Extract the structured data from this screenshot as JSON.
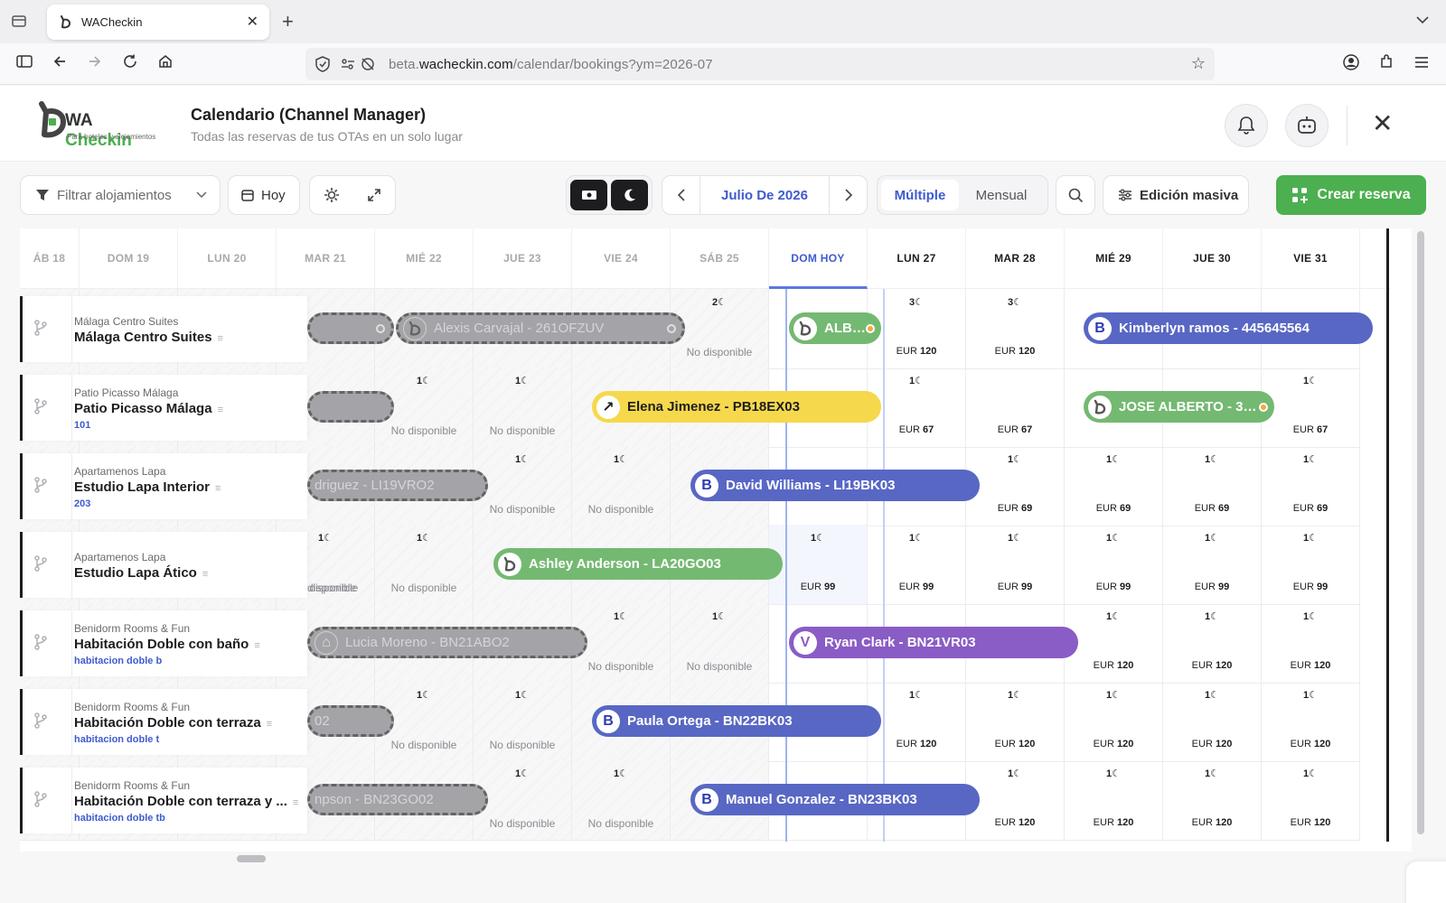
{
  "browser": {
    "tab_title": "WACheckin",
    "url_prefix": "beta.",
    "url_domain": "wacheckin.com",
    "url_path": "/calendar/bookings?ym=2026-07"
  },
  "header": {
    "logo_text_a": "WA ",
    "logo_text_b": "Checkin",
    "logo_tagline": "Para hoteles y alojamientos",
    "title": "Calendario (Channel Manager)",
    "subtitle": "Todas las reservas de tus OTAs en un solo lugar"
  },
  "toolbar": {
    "filter_label": "Filtrar alojamientos",
    "today_label": "Hoy",
    "month_label": "Julio De 2026",
    "view_multiple": "Múltiple",
    "view_monthly": "Mensual",
    "bulk_edit": "Edición masiva",
    "create": "Crear reserva"
  },
  "colors": {
    "accent": "#4caf50",
    "today": "#3e5bcf",
    "booking_blue": "#5867c4",
    "booking_green": "#74b972",
    "booking_yellow": "#f6d84c",
    "booking_purple": "#8a5cc5"
  },
  "days": [
    "ÁB 18",
    "DOM 19",
    "LUN 20",
    "MAR 21",
    "MIÉ 22",
    "JUE 23",
    "VIE 24",
    "SÁB 25",
    "DOM HOY",
    "LUN 27",
    "MAR 28",
    "MIÉ 29",
    "JUE 30",
    "VIE 31"
  ],
  "properties": [
    {
      "owner": "Málaga Centro Suites",
      "name": "Málaga Centro Suites",
      "unit": ""
    },
    {
      "owner": "Patio Picasso Málaga",
      "name": "Patio Picasso Málaga",
      "unit": "101"
    },
    {
      "owner": "Apartamenos Lapa",
      "name": "Estudio Lapa Interior",
      "unit": "203"
    },
    {
      "owner": "Apartamenos Lapa",
      "name": "Estudio Lapa Ático",
      "unit": ""
    },
    {
      "owner": "Benidorm Rooms & Fun",
      "name": "Habitación Doble con baño",
      "unit": "habitacion doble b"
    },
    {
      "owner": "Benidorm Rooms & Fun",
      "name": "Habitación Doble con terraza",
      "unit": "habitacion doble t"
    },
    {
      "owner": "Benidorm Rooms & Fun",
      "name": "Habitación Doble con terraza y ...",
      "unit": "habitacion doble tb"
    }
  ],
  "cells": {
    "r0": [
      {
        "m": "",
        "t": ""
      },
      {
        "m": "",
        "t": ""
      },
      {
        "m": "",
        "t": ""
      },
      {
        "m": "",
        "t": ""
      },
      {
        "m": "",
        "t": ""
      },
      {
        "m": "",
        "t": ""
      },
      {
        "m": "",
        "t": ""
      },
      {
        "m": "2☾",
        "t": "No disponible",
        "nd": true
      },
      {
        "m": "",
        "t": ""
      },
      {
        "m": "3☾",
        "cur": "EUR",
        "amt": "120"
      },
      {
        "m": "3☾",
        "cur": "EUR",
        "amt": "120"
      },
      {
        "m": "",
        "t": ""
      },
      {
        "m": "",
        "t": ""
      },
      {
        "m": "",
        "t": ""
      }
    ],
    "r1": [
      {
        "m": "",
        "t": ""
      },
      {
        "m": "",
        "t": ""
      },
      {
        "m": "",
        "t": ""
      },
      {
        "m": "",
        "t": ""
      },
      {
        "m": "1☾",
        "t": "No disponible",
        "nd": true
      },
      {
        "m": "1☾",
        "t": "No disponible",
        "nd": true
      },
      {
        "m": "",
        "t": ""
      },
      {
        "m": "",
        "t": ""
      },
      {
        "m": "",
        "t": ""
      },
      {
        "m": "1☾",
        "cur": "EUR",
        "amt": "67"
      },
      {
        "m": "",
        "cur": "EUR",
        "amt": "67"
      },
      {
        "m": "",
        "t": ""
      },
      {
        "m": "",
        "t": ""
      },
      {
        "m": "1☾",
        "cur": "EUR",
        "amt": "67"
      }
    ],
    "r2": [
      {
        "m": "",
        "t": ""
      },
      {
        "m": "",
        "t": ""
      },
      {
        "m": "",
        "t": ""
      },
      {
        "m": "",
        "t": ""
      },
      {
        "m": "",
        "t": ""
      },
      {
        "m": "1☾",
        "t": "No disponible",
        "nd": true
      },
      {
        "m": "1☾",
        "t": "No disponible",
        "nd": true
      },
      {
        "m": "",
        "t": ""
      },
      {
        "m": "",
        "t": ""
      },
      {
        "m": "",
        "t": ""
      },
      {
        "m": "1☾",
        "cur": "EUR",
        "amt": "69"
      },
      {
        "m": "1☾",
        "cur": "EUR",
        "amt": "69"
      },
      {
        "m": "1☾",
        "cur": "EUR",
        "amt": "69"
      },
      {
        "m": "1☾",
        "cur": "EUR",
        "amt": "69"
      }
    ],
    "r3": [
      {
        "m": "",
        "t": ""
      },
      {
        "m": "",
        "t": ""
      },
      {
        "m": "",
        "t": ""
      },
      {
        "m": "1☾",
        "t": "No disponible",
        "nd": true
      },
      {
        "m": "1☾",
        "t": "No disponible",
        "nd": true
      },
      {
        "m": "",
        "t": ""
      },
      {
        "m": "",
        "t": ""
      },
      {
        "m": "",
        "t": ""
      },
      {
        "m": "1☾",
        "cur": "EUR",
        "amt": "99"
      },
      {
        "m": "1☾",
        "cur": "EUR",
        "amt": "99"
      },
      {
        "m": "1☾",
        "cur": "EUR",
        "amt": "99"
      },
      {
        "m": "1☾",
        "cur": "EUR",
        "amt": "99"
      },
      {
        "m": "1☾",
        "cur": "EUR",
        "amt": "99"
      },
      {
        "m": "1☾",
        "cur": "EUR",
        "amt": "99"
      }
    ],
    "r4": [
      {
        "m": "",
        "t": ""
      },
      {
        "m": "",
        "t": ""
      },
      {
        "m": "",
        "t": ""
      },
      {
        "m": "",
        "t": ""
      },
      {
        "m": "",
        "t": ""
      },
      {
        "m": "",
        "t": ""
      },
      {
        "m": "1☾",
        "t": "No disponible",
        "nd": true
      },
      {
        "m": "1☾",
        "t": "No disponible",
        "nd": true
      },
      {
        "m": "",
        "t": ""
      },
      {
        "m": "",
        "t": ""
      },
      {
        "m": "",
        "t": ""
      },
      {
        "m": "1☾",
        "cur": "EUR",
        "amt": "120"
      },
      {
        "m": "1☾",
        "cur": "EUR",
        "amt": "120"
      },
      {
        "m": "1☾",
        "cur": "EUR",
        "amt": "120"
      }
    ],
    "r5": [
      {
        "m": "",
        "t": ""
      },
      {
        "m": "",
        "t": ""
      },
      {
        "m": "",
        "t": ""
      },
      {
        "m": "",
        "t": ""
      },
      {
        "m": "1☾",
        "t": "No disponible",
        "nd": true
      },
      {
        "m": "1☾",
        "t": "No disponible",
        "nd": true
      },
      {
        "m": "",
        "t": ""
      },
      {
        "m": "",
        "t": ""
      },
      {
        "m": "",
        "t": ""
      },
      {
        "m": "1☾",
        "cur": "EUR",
        "amt": "120"
      },
      {
        "m": "1☾",
        "cur": "EUR",
        "amt": "120"
      },
      {
        "m": "1☾",
        "cur": "EUR",
        "amt": "120"
      },
      {
        "m": "1☾",
        "cur": "EUR",
        "amt": "120"
      },
      {
        "m": "1☾",
        "cur": "EUR",
        "amt": "120"
      }
    ],
    "r6": [
      {
        "m": "",
        "t": ""
      },
      {
        "m": "",
        "t": ""
      },
      {
        "m": "",
        "t": ""
      },
      {
        "m": "",
        "t": ""
      },
      {
        "m": "",
        "t": ""
      },
      {
        "m": "1☾",
        "t": "No disponible",
        "nd": true
      },
      {
        "m": "1☾",
        "t": "No disponible",
        "nd": true
      },
      {
        "m": "",
        "t": ""
      },
      {
        "m": "",
        "t": ""
      },
      {
        "m": "",
        "t": ""
      },
      {
        "m": "1☾",
        "cur": "EUR",
        "amt": "120"
      },
      {
        "m": "1☾",
        "cur": "EUR",
        "amt": "120"
      },
      {
        "m": "1☾",
        "cur": "EUR",
        "amt": "120"
      },
      {
        "m": "1☾",
        "cur": "EUR",
        "amt": "120"
      }
    ]
  },
  "extra_unavail": {
    "r3_label": "disponible"
  },
  "bookings": [
    {
      "id": "b-ghost-0a",
      "label": "",
      "style": "ghost",
      "icon": ""
    },
    {
      "id": "b-ghost-0b",
      "label": "Alexis Carvajal - 261OFZUV",
      "style": "ghost",
      "icon": "wa"
    },
    {
      "id": "b-albe",
      "label": "ALBE...",
      "style": "green",
      "icon": "wa"
    },
    {
      "id": "b-kimberlyn",
      "label": "Kimberlyn ramos - 445645564",
      "style": "blue",
      "icon": "B"
    },
    {
      "id": "b-ghost-1",
      "label": "",
      "style": "ghost",
      "icon": ""
    },
    {
      "id": "b-elena",
      "label": "Elena Jimenez - PB18EX03",
      "style": "yellow",
      "icon": "↗"
    },
    {
      "id": "b-jose",
      "label": "JOSE ALBERTO - 343...",
      "style": "green",
      "icon": "wa"
    },
    {
      "id": "b-ghost-2",
      "label": "driguez - LI19VRO2",
      "style": "ghost",
      "icon": ""
    },
    {
      "id": "b-david",
      "label": "David Williams - LI19BK03",
      "style": "blue",
      "icon": "B"
    },
    {
      "id": "b-ashley",
      "label": "Ashley Anderson - LA20GO03",
      "style": "green",
      "icon": "wa"
    },
    {
      "id": "b-ghost-4",
      "label": "Lucia Moreno - BN21ABO2",
      "style": "ghost",
      "icon": "⌂"
    },
    {
      "id": "b-ryan",
      "label": "Ryan Clark - BN21VR03",
      "style": "purple",
      "icon": "V"
    },
    {
      "id": "b-ghost-5",
      "label": "02",
      "style": "ghost",
      "icon": ""
    },
    {
      "id": "b-paula",
      "label": "Paula Ortega - BN22BK03",
      "style": "blue",
      "icon": "B"
    },
    {
      "id": "b-ghost-6",
      "label": "npson - BN23GO02",
      "style": "ghost",
      "icon": ""
    },
    {
      "id": "b-manuel",
      "label": "Manuel Gonzalez - BN23BK03",
      "style": "blue",
      "icon": "B"
    }
  ]
}
